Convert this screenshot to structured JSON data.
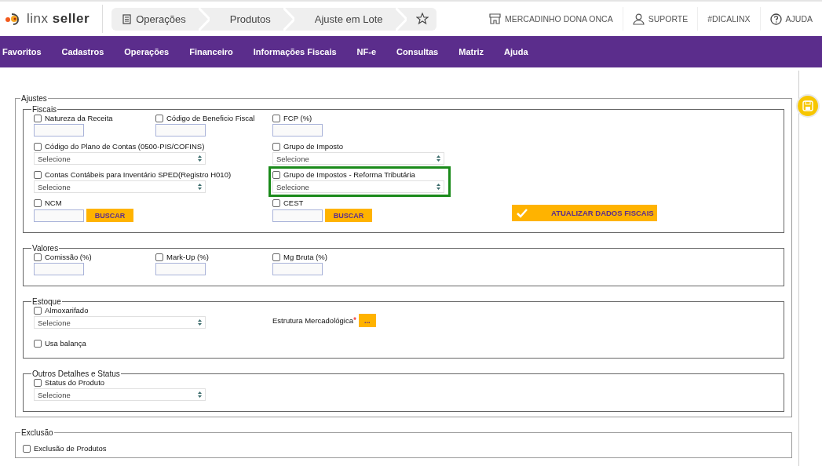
{
  "header": {
    "logo": "linx **seller**",
    "breadcrumbs": [
      {
        "label": "Operações"
      },
      {
        "label": "Produtos"
      },
      {
        "label": "Ajuste em Lote"
      }
    ],
    "links": [
      {
        "label": "MERCADINHO DONA ONCA",
        "kind": "store"
      },
      {
        "label": "SUPORTE",
        "kind": "user"
      },
      {
        "label": "#DICALINX",
        "kind": "none"
      },
      {
        "label": "AJUDA",
        "kind": "help"
      }
    ]
  },
  "menu": [
    "Favoritos",
    "Cadastros",
    "Operações",
    "Financeiro",
    "Informações Fiscais",
    "NF-e",
    "Consultas",
    "Matriz",
    "Ajuda"
  ],
  "panels": [
    {
      "legend": "Ajustes",
      "groups": [
        {
          "legend": "Fiscais",
          "rows": [
            {
              "left": [
                {
                  "kind": "text",
                  "label": "Natureza da Receita",
                  "checked": false
                },
                {
                  "kind": "text",
                  "label": "Código de Beneficio Fiscal",
                  "checked": false
                }
              ],
              "right": [
                {
                  "kind": "text",
                  "label": "FCP (%)",
                  "checked": false
                }
              ]
            },
            {
              "left": [
                {
                  "kind": "select",
                  "label": "Código do Plano de Contas (0500-PIS/COFINS)",
                  "checked": false,
                  "placeholder": "Selecione"
                }
              ],
              "right": [
                {
                  "kind": "select",
                  "label": "Grupo de Imposto",
                  "checked": false,
                  "placeholder": "Selecione"
                }
              ]
            },
            {
              "left": [
                {
                  "kind": "select",
                  "label": "Contas Contábeis para Inventário SPED(Registro H010)",
                  "checked": false,
                  "placeholder": "Selecione"
                }
              ],
              "right": [
                {
                  "kind": "select",
                  "label": "Grupo de Impostos - Reforma Tributária",
                  "checked": false,
                  "placeholder": "Selecione",
                  "highlighted": true
                }
              ]
            },
            {
              "left": [
                {
                  "kind": "search",
                  "label": "NCM",
                  "checked": false,
                  "button": "BUSCAR"
                }
              ],
              "right": [
                {
                  "kind": "search",
                  "label": "CEST",
                  "checked": false,
                  "button": "BUSCAR"
                },
                {
                  "kind": "action",
                  "label": "ATUALIZAR DADOS FISCAIS"
                }
              ]
            }
          ]
        },
        {
          "legend": "Valores",
          "rows": [
            {
              "left": [
                {
                  "kind": "text",
                  "label": "Comissão (%)",
                  "checked": false
                },
                {
                  "kind": "text",
                  "label": "Mark-Up (%)",
                  "checked": false
                }
              ],
              "right": [
                {
                  "kind": "text",
                  "label": "Mg Bruta (%)",
                  "checked": false
                }
              ]
            }
          ]
        },
        {
          "legend": "Estoque",
          "rows": [
            {
              "left": [
                {
                  "kind": "select",
                  "label": "Almoxarifado",
                  "checked": false,
                  "placeholder": "Selecione"
                }
              ],
              "right": [
                {
                  "kind": "picker",
                  "label": "Estrutura Mercadológica",
                  "marker": "*",
                  "button": "..."
                }
              ]
            },
            {
              "left": [
                {
                  "kind": "checkbox",
                  "label": "Usa balança",
                  "checked": false
                }
              ],
              "right": []
            }
          ]
        },
        {
          "legend": "Outros Detalhes e Status",
          "rows": [
            {
              "left": [
                {
                  "kind": "select",
                  "label": "Status do Produto",
                  "checked": false,
                  "placeholder": "Selecione"
                }
              ],
              "right": []
            }
          ]
        }
      ]
    },
    {
      "legend": "Exclusão",
      "rows": [
        {
          "left": [
            {
              "kind": "checkbox",
              "label": "Exclusão de Produtos",
              "checked": false
            }
          ],
          "right": []
        }
      ]
    }
  ]
}
